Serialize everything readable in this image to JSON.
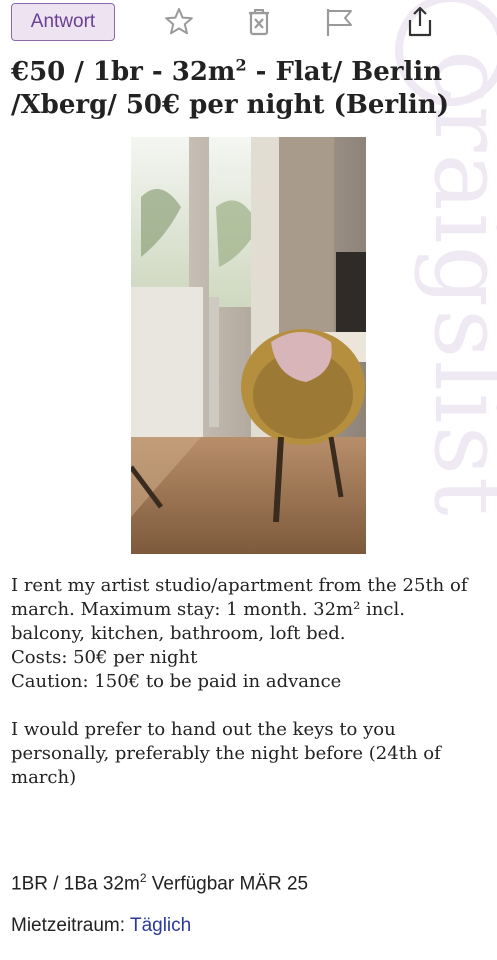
{
  "toolbar": {
    "reply_label": "Antwort",
    "icons": [
      "star-icon",
      "trash-icon",
      "flag-icon",
      "share-icon"
    ]
  },
  "post": {
    "title_a": "€50 / 1br - 32m",
    "title_sup": "2",
    "title_b": " - Flat/ Berlin /Xberg/ 50€ per night (Berlin)",
    "body": {
      "line1": "I rent my artist studio/apartment from the 25th of march. Maximum stay: 1 month. 32m² incl. balcony, kitchen, bathroom, loft bed.",
      "line2": "Costs: 50€ per night",
      "line3": "Caution: 150€ to be paid in advance",
      "line4": "I would prefer to hand out the keys to you personally, preferably the night before (24th of march)"
    },
    "attributes": {
      "prefix": "1BR / 1Ba 32m",
      "sup": "2",
      "suffix": " Verfügbar MÄR 25"
    },
    "rental": {
      "label": "Mietzeitraum:",
      "value": "Täglich"
    }
  },
  "watermark": "craigslist",
  "colors": {
    "reply_bg": "#ede3f1",
    "reply_border": "#8a6aa8",
    "reply_text": "#6b3f93",
    "link": "#2a3a9c",
    "watermark": "#efe9f3"
  }
}
